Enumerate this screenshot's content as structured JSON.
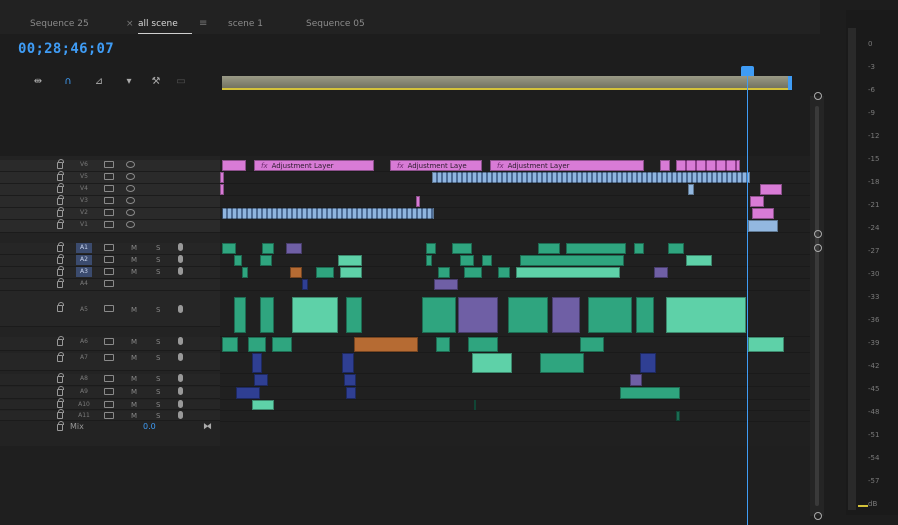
{
  "tabs": [
    {
      "label": "Sequence 25",
      "active": false
    },
    {
      "label": "all scene",
      "active": true
    },
    {
      "label": "scene 1",
      "active": false
    },
    {
      "label": "Sequence 05",
      "active": false
    }
  ],
  "tab_close_glyph": "×",
  "tab_menu_glyph": "≡",
  "timecode": "00;28;46;07",
  "tools": [
    {
      "icon": "insert-edit-icon"
    },
    {
      "icon": "snap-magnet-icon"
    },
    {
      "icon": "linked-selection-icon"
    },
    {
      "icon": "add-marker-icon"
    },
    {
      "icon": "wrench-settings-icon"
    },
    {
      "icon": "captions-icon"
    }
  ],
  "video_tracks": [
    "V6",
    "V5",
    "V4",
    "V3",
    "V2",
    "V1"
  ],
  "audio_tracks": [
    {
      "name": "A1",
      "selected": true
    },
    {
      "name": "A2",
      "selected": true
    },
    {
      "name": "A3",
      "selected": true
    },
    {
      "name": "A4",
      "selected": false
    },
    {
      "name": "A5",
      "selected": false
    },
    {
      "name": "A6",
      "selected": false
    },
    {
      "name": "A7",
      "selected": false
    },
    {
      "name": "A8",
      "selected": false
    },
    {
      "name": "A9",
      "selected": false
    },
    {
      "name": "A10",
      "selected": false
    },
    {
      "name": "A11",
      "selected": false
    }
  ],
  "mute_label": "M",
  "solo_label": "S",
  "mix": {
    "label": "Mix",
    "value": "0.0"
  },
  "adjustment_layers": [
    {
      "label": "Adjustment Layer"
    },
    {
      "label": "Adjustment Laye"
    },
    {
      "label": "Adjustment Layer"
    }
  ],
  "fx_badge": "fx",
  "meter_scale": [
    "0",
    "-3",
    "-6",
    "-9",
    "-12",
    "-15",
    "-18",
    "-21",
    "-24",
    "-27",
    "-30",
    "-33",
    "-36",
    "-39",
    "-42",
    "-45",
    "-48",
    "-51",
    "-54",
    "-57",
    "dB"
  ],
  "colors": {
    "accent": "#3f9cf5",
    "adjustment": "#d87bd6",
    "video_clip": "#93b8e0",
    "audio_clip": "#2fa57f",
    "work_area": "#d3c13a"
  }
}
